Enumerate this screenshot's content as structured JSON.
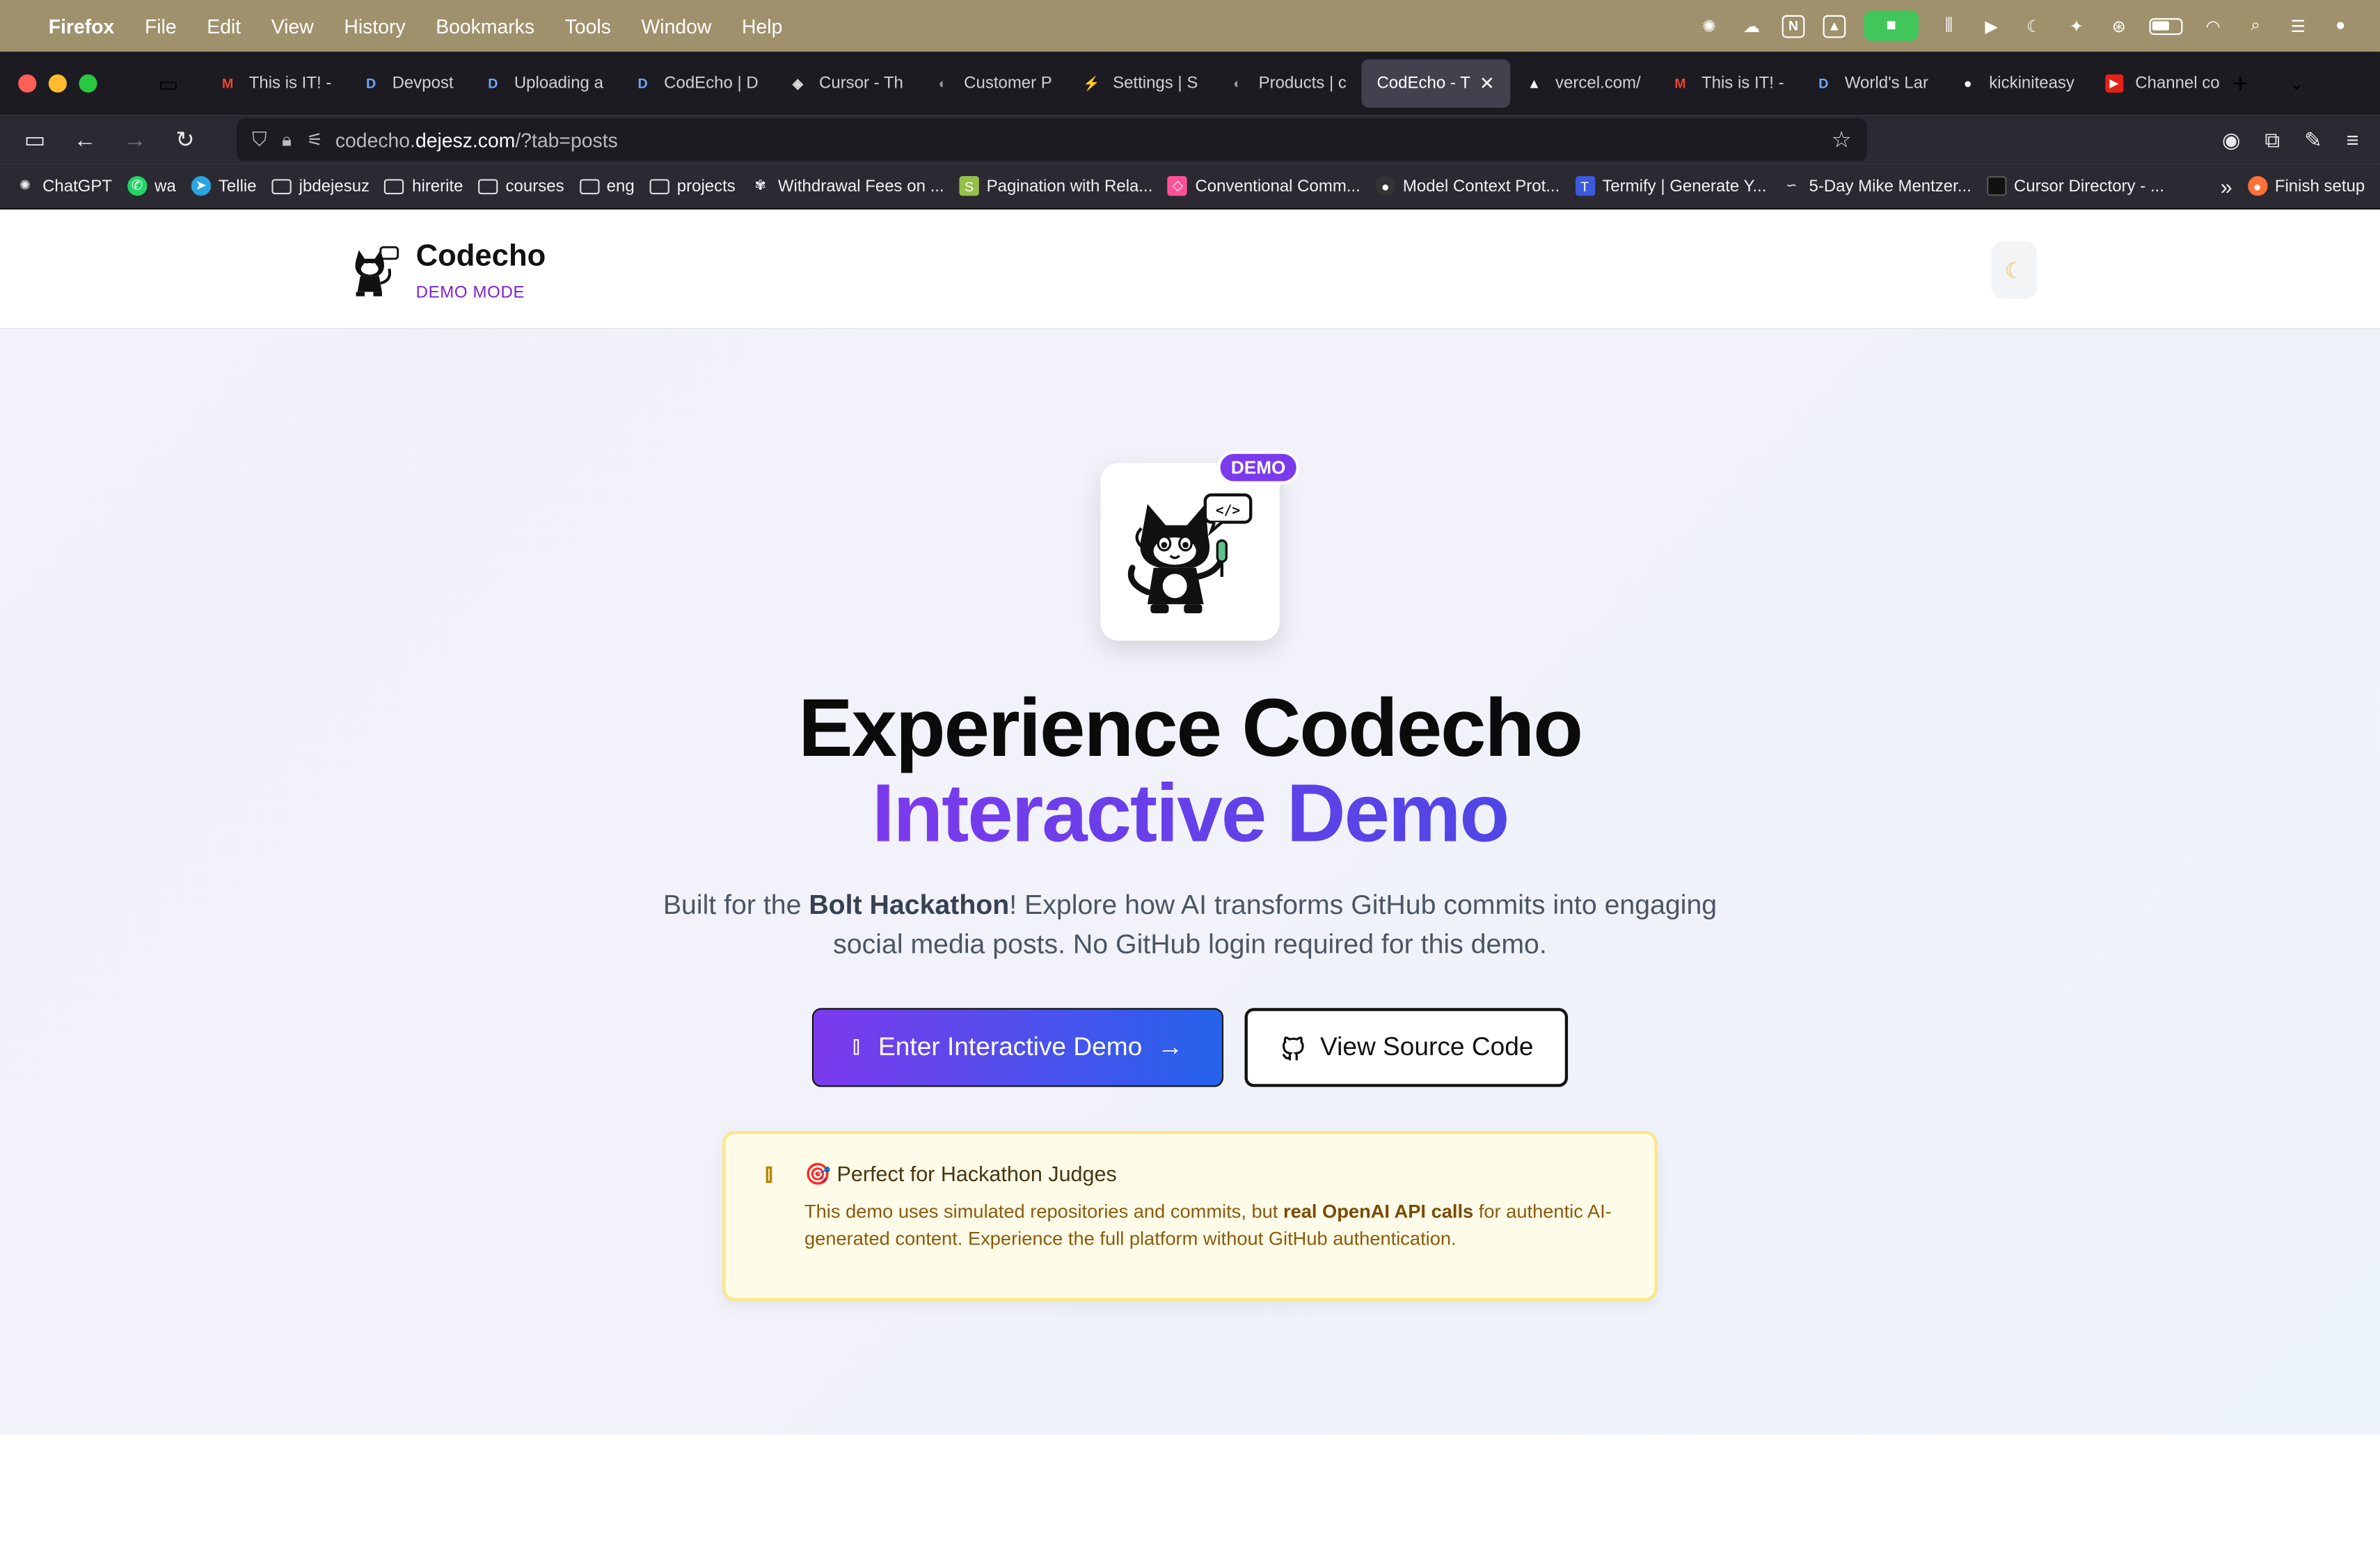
{
  "menubar": {
    "app": "Firefox",
    "items": [
      "File",
      "Edit",
      "View",
      "History",
      "Bookmarks",
      "Tools",
      "Window",
      "Help"
    ]
  },
  "tabs": [
    {
      "label": "This is IT! -",
      "favicon": "gmail-icon"
    },
    {
      "label": "Devpost",
      "favicon": "devpost-icon"
    },
    {
      "label": "Uploading a",
      "favicon": "devpost-icon"
    },
    {
      "label": "CodEcho | D",
      "favicon": "devpost-icon"
    },
    {
      "label": "Cursor - Th",
      "favicon": "cursor-icon"
    },
    {
      "label": "Customer P",
      "favicon": "circle-icon"
    },
    {
      "label": "Settings | S",
      "favicon": "bolt-icon"
    },
    {
      "label": "Products | c",
      "favicon": "circle-icon"
    },
    {
      "label": "CodEcho - T",
      "favicon": "none",
      "active": true
    },
    {
      "label": "vercel.com/",
      "favicon": "vercel-icon"
    },
    {
      "label": "This is IT! -",
      "favicon": "gmail-icon"
    },
    {
      "label": "World's Lar",
      "favicon": "devpost-icon"
    },
    {
      "label": "kickiniteasy",
      "favicon": "github-icon"
    },
    {
      "label": "Channel co",
      "favicon": "youtube-icon"
    }
  ],
  "url": {
    "prefix": "codecho.",
    "host": "dejesz.com",
    "path": "/?tab=posts"
  },
  "bookmarks": [
    {
      "label": "ChatGPT",
      "type": "site"
    },
    {
      "label": "wa",
      "type": "site"
    },
    {
      "label": "Tellie",
      "type": "site"
    },
    {
      "label": "jbdejesuz",
      "type": "folder"
    },
    {
      "label": "hirerite",
      "type": "folder"
    },
    {
      "label": "courses",
      "type": "folder"
    },
    {
      "label": "eng",
      "type": "folder"
    },
    {
      "label": "projects",
      "type": "folder"
    },
    {
      "label": "Withdrawal Fees on ...",
      "type": "site"
    },
    {
      "label": "Pagination with Rela...",
      "type": "site"
    },
    {
      "label": "Conventional Comm...",
      "type": "site"
    },
    {
      "label": "Model Context Prot...",
      "type": "site"
    },
    {
      "label": "Termify | Generate Y...",
      "type": "site"
    },
    {
      "label": "5-Day Mike Mentzer...",
      "type": "site"
    },
    {
      "label": "Cursor Directory - ...",
      "type": "site"
    }
  ],
  "bookmarks_end": "Finish setup",
  "site": {
    "name": "Codecho",
    "mode": "DEMO MODE",
    "badge": "DEMO",
    "headline_1": "Experience Codecho",
    "headline_2": "Interactive Demo",
    "lead_1": "Built for the ",
    "lead_bold": "Bolt Hackathon",
    "lead_2": "! Explore how AI transforms GitHub commits into engaging social media posts. No GitHub login required for this demo.",
    "primary_button": "Enter Interactive Demo",
    "secondary_button": "View Source Code",
    "notice_title": "🎯 Perfect for Hackathon Judges",
    "notice_body_1": "This demo uses simulated repositories and commits, but ",
    "notice_body_bold": "real OpenAI API calls",
    "notice_body_2": " for authentic AI-generated content. Experience the full platform without GitHub authentication."
  },
  "colors": {
    "accent_purple": "#7c3aed",
    "accent_blue": "#2563eb",
    "notice_bg": "#fefbe8"
  }
}
